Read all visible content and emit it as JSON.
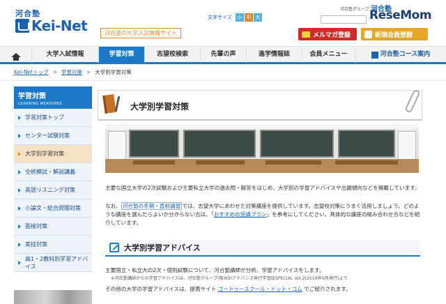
{
  "header": {
    "kawai_label": "河合塾",
    "logo_text": "Kei-Net",
    "tagline": "河合塾の大学入試情報サイト",
    "font_size_label": "文字サイズ",
    "font_size_options": [
      "小",
      "中",
      "大"
    ],
    "group_label": "河合塾グループ",
    "group_name": "河合塾",
    "watermark": "ReseMom",
    "mail_button": "メルマガ登録",
    "register_button": "新規会員登録"
  },
  "nav": {
    "items": [
      "大学入試情報",
      "学習対策",
      "志望校検索",
      "先輩の声",
      "進学情報誌",
      "会員メニュー"
    ],
    "course_link": "河合塾コース案内",
    "active_index": 1
  },
  "breadcrumb": {
    "items": [
      "Kei-Netトップ",
      "学習対策",
      "大学別学習対策"
    ]
  },
  "sidebar": {
    "title": "学習対策",
    "subtitle": "LEARNING MEASURES",
    "items": [
      "学習対策トップ",
      "センター試験対策",
      "大学別学習対策",
      "全統模試・解説講義",
      "英語リスニング対策",
      "小論文・総合問題対策",
      "面接対策",
      "実技対策",
      "高1・2教科別学習アドバイス"
    ],
    "active_index": 2
  },
  "main": {
    "page_title": "大学別学習対策",
    "intro": "主要な国立大学の2次試験および主要私立大学の過去問・解答をはじめ、大学別の学習アドバイスや出題傾向などを掲載しています。",
    "p2_pre": "なお、",
    "p2_link": "河合塾の冬期・直前講習",
    "p2_mid": "では、志望大学にあわせた対策講座を提供しています。志望校対策にうまく活用しましょう。どのような講座を選んだらよいか分からない方は、「",
    "p2_link2": "おすすめの受講プラン",
    "p2_post": "」を参考にしてください。具体的な講座の組み合わせ方などを紹介しています。",
    "section_title": "大学別学習アドバイス",
    "advice_text": "主要国立・私立大の2次・個別試験について、河合塾講師が分析、学習アドバイスをします。",
    "advice_note": "※河合塾講師からの学習アドバイスは、河合塾グループ(株)KEIアドバンス発行学習誌SPECIAL Vol.2(2016年9月発行)より",
    "other_pre": "その他の大学の学習アドバイスは、提携サイト ",
    "other_link": "ゴートゥースクール・ドット・コム",
    "other_post": " でご紹介されます。"
  },
  "colors": {
    "brand_blue": "#1e78c8",
    "accent_orange": "#e08a2c",
    "mail_red": "#d32b2b",
    "register_gold": "#e6a62a"
  }
}
